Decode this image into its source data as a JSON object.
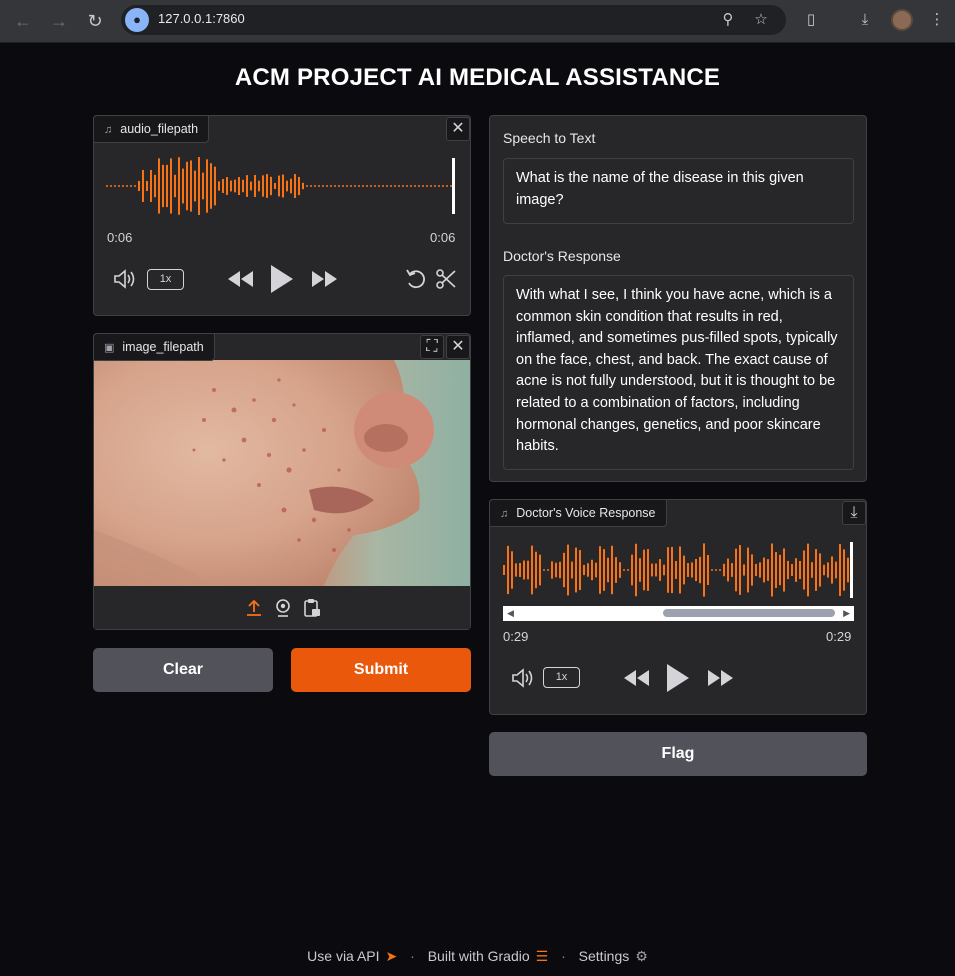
{
  "browser": {
    "url": "127.0.0.1:7860"
  },
  "page": {
    "title": "ACM PROJECT AI MEDICAL ASSISTANCE"
  },
  "audio_input": {
    "label": "audio_filepath",
    "time_current": "0:06",
    "time_total": "0:06",
    "rate": "1x",
    "waveform_color": "#f97316"
  },
  "image_input": {
    "label": "image_filepath"
  },
  "buttons": {
    "clear": "Clear",
    "submit": "Submit",
    "flag": "Flag"
  },
  "speech_to_text": {
    "label": "Speech to Text",
    "value": " What is the name of the disease in this given image?"
  },
  "doctor_response": {
    "label": "Doctor's Response",
    "value": "With what I see, I think you have acne, which is a common skin condition that results in red, inflamed, and sometimes pus-filled spots, typically on the face, chest, and back. The exact cause of acne is not fully understood, but it is thought to be related to a combination of factors, including hormonal changes, genetics, and poor skincare habits."
  },
  "voice_response": {
    "label": "Doctor's Voice Response",
    "time_current": "0:29",
    "time_total": "0:29",
    "rate": "1x"
  },
  "footer": {
    "api": "Use via API",
    "built": "Built with Gradio",
    "settings": "Settings"
  },
  "colors": {
    "accent": "#ea580c",
    "background": "#0b0b0f",
    "panel": "#27272a"
  }
}
